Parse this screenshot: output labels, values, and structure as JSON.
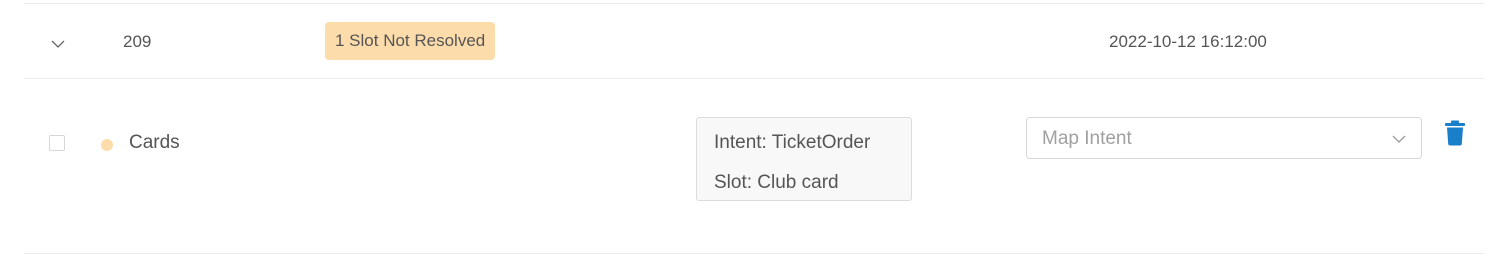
{
  "group_row": {
    "id": "209",
    "status_badge": "1 Slot Not Resolved",
    "timestamp": "2022-10-12 16:12:00",
    "expand_icon": "chevron-down-icon"
  },
  "child_row": {
    "label": "Cards",
    "checked": false,
    "status_dot_color": "#fddcab",
    "intent_line": "Intent: TicketOrder",
    "slot_line": "Slot: Club card",
    "map_select": {
      "placeholder": "Map Intent",
      "icon": "chevron-down-icon"
    },
    "delete_icon": "trash-icon"
  },
  "colors": {
    "badge_bg": "#fddcab",
    "delete_icon": "#1a7fc9",
    "divider": "#ececec"
  }
}
